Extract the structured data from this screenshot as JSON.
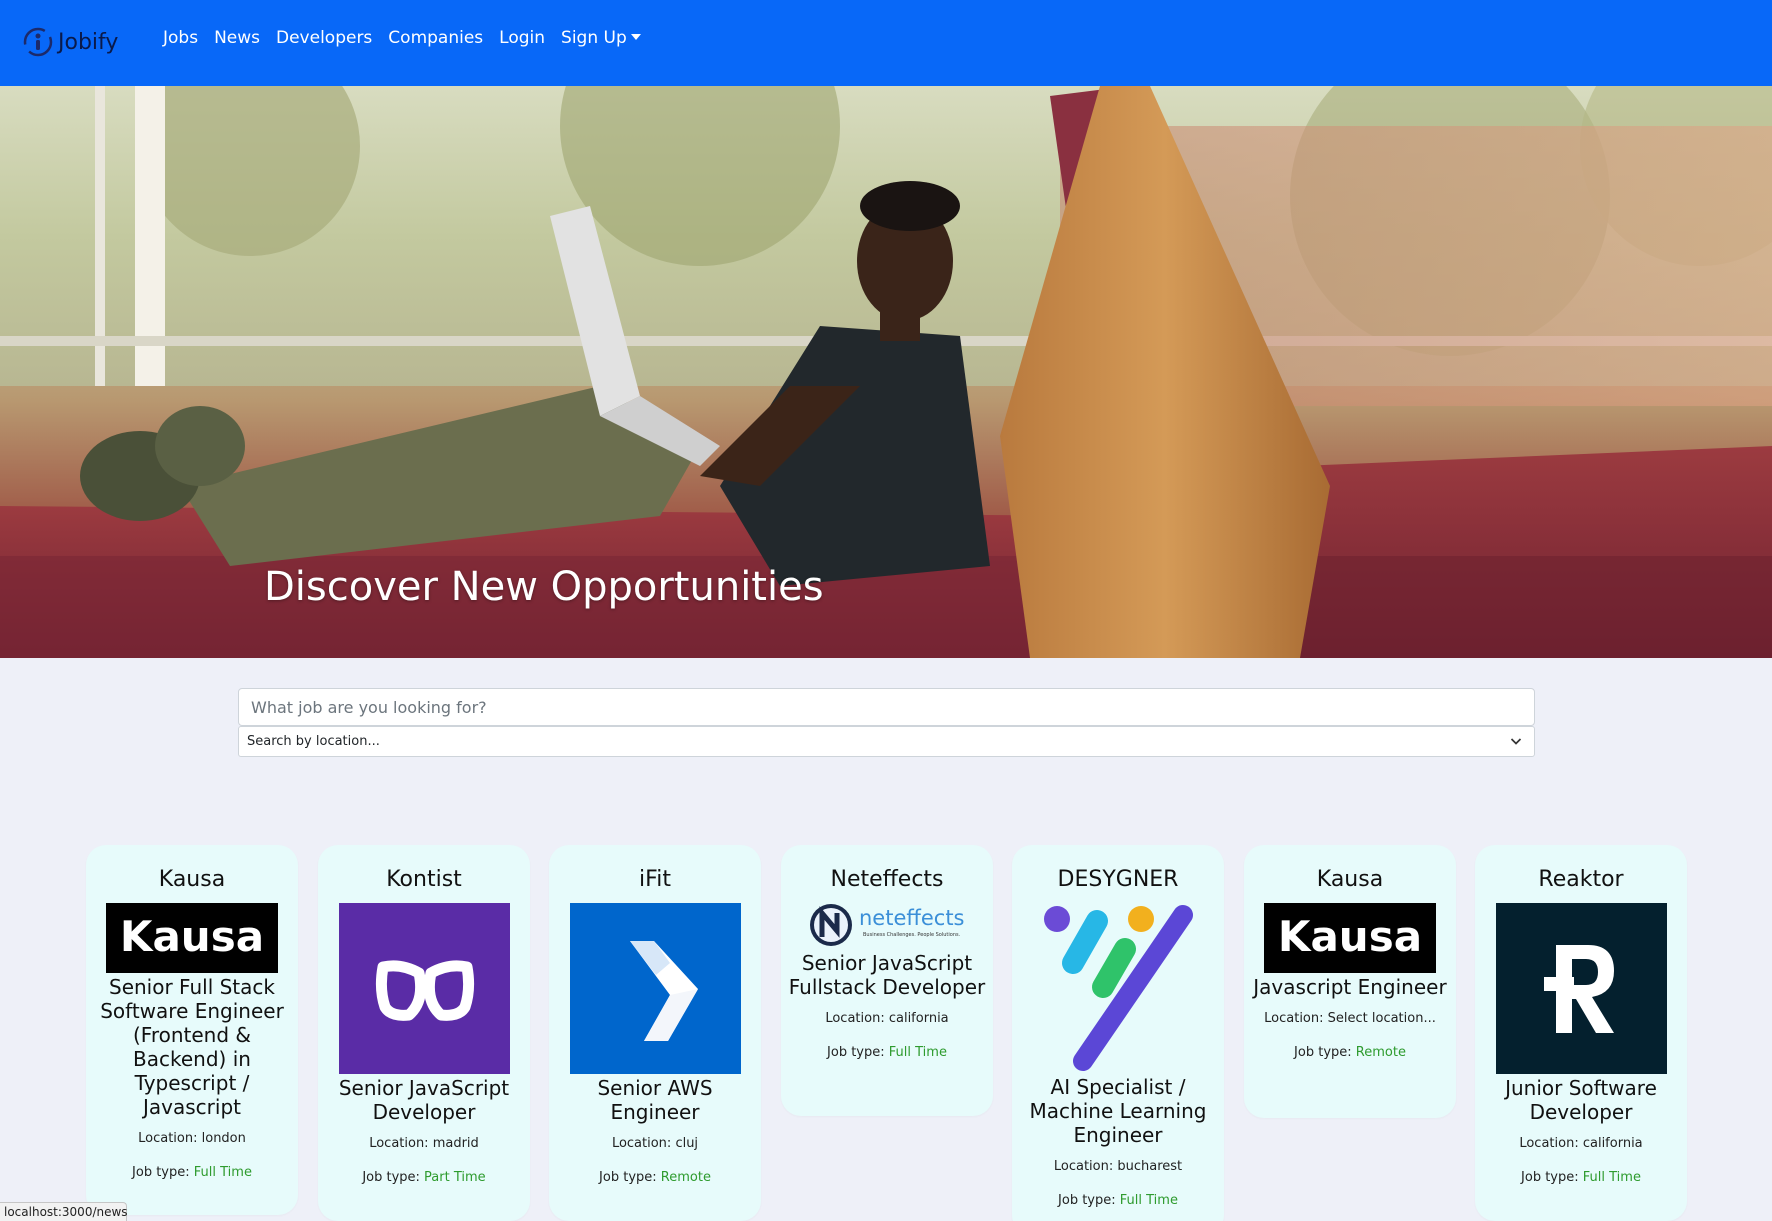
{
  "brand": {
    "name": "Jobify"
  },
  "nav": {
    "items": [
      {
        "label": "Jobs"
      },
      {
        "label": "News"
      },
      {
        "label": "Developers"
      },
      {
        "label": "Companies"
      },
      {
        "label": "Login"
      },
      {
        "label": "Sign Up"
      }
    ]
  },
  "hero": {
    "title": "Discover New Opportunities"
  },
  "search": {
    "placeholder": "What job are you looking for?",
    "location_value": "Search by location..."
  },
  "colors": {
    "navbar": "#0868f8",
    "card_bg": "#e7fbfb",
    "job_type": "#2e9b2e",
    "page_bg": "#eef0f8"
  },
  "jobs": [
    {
      "company": "Kausa",
      "title": "Senior Full Stack Software Engineer (Frontend & Backend) in Typescript / Javascript",
      "location_label": "Location: ",
      "location": "london",
      "type_label": "Job type: ",
      "type": "Full Time",
      "logo_icon": "kausa-logo"
    },
    {
      "company": "Kontist",
      "title": "Senior JavaScript Developer",
      "location_label": "Location: ",
      "location": "madrid",
      "type_label": "Job type: ",
      "type": "Part Time",
      "logo_icon": "kontist-logo"
    },
    {
      "company": "iFit",
      "title": "Senior AWS Engineer",
      "location_label": "Location: ",
      "location": "cluj",
      "type_label": "Job type: ",
      "type": "Remote",
      "logo_icon": "ifit-logo"
    },
    {
      "company": "Neteffects",
      "title": "Senior JavaScript Fullstack Developer",
      "location_label": "Location: ",
      "location": "california",
      "type_label": "Job type: ",
      "type": "Full Time",
      "logo_icon": "neteffects-logo",
      "logo_text": "neteffects",
      "logo_tagline": "Business Challenges. People Solutions."
    },
    {
      "company": "DESYGNER",
      "title": "AI Specialist / Machine Learning Engineer",
      "location_label": "Location: ",
      "location": "bucharest",
      "type_label": "Job type: ",
      "type": "Full Time",
      "logo_icon": "desygner-logo"
    },
    {
      "company": "Kausa",
      "title": "Javascript Engineer",
      "location_label": "Location: ",
      "location": "Select location...",
      "type_label": "Job type: ",
      "type": "Remote",
      "logo_icon": "kausa-logo"
    },
    {
      "company": "Reaktor",
      "title": "Junior Software Developer",
      "location_label": "Location: ",
      "location": "california",
      "type_label": "Job type: ",
      "type": "Full Time",
      "logo_icon": "reaktor-logo"
    }
  ],
  "kausa_logo_text": "Kausa",
  "status_bar": {
    "url": "localhost:3000/news"
  }
}
